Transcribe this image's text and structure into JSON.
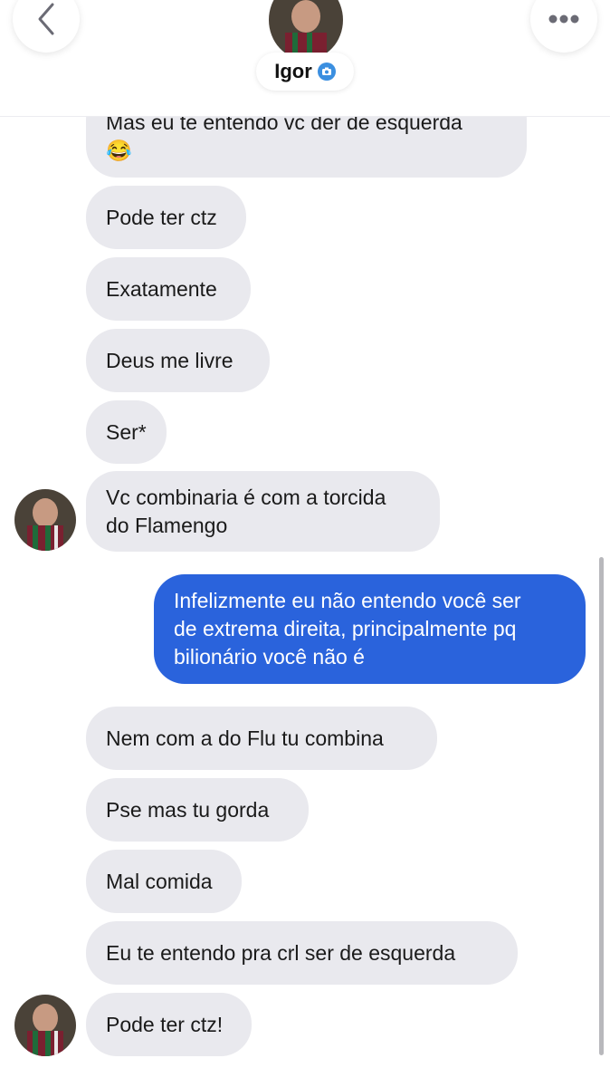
{
  "header": {
    "contact_name": "Igor",
    "icons": {
      "back": "chevron-left-icon",
      "more": "more-dots-icon",
      "verified": "verified-camera-icon"
    }
  },
  "colors": {
    "incoming_bubble": "#e9e9ee",
    "outgoing_bubble": "#2a63dc",
    "verified_badge": "#3b8fe0"
  },
  "messages": [
    {
      "dir": "in",
      "text": "Mas eu te entendo vc der de esquerda\n😂"
    },
    {
      "dir": "in",
      "text": "Pode ter ctz"
    },
    {
      "dir": "in",
      "text": "Exatamente"
    },
    {
      "dir": "in",
      "text": "Deus me livre"
    },
    {
      "dir": "in",
      "text": "Ser*"
    },
    {
      "dir": "in",
      "text": "Vc combinaria é com a torcida\ndo Flamengo"
    },
    {
      "dir": "out",
      "text": "Infelizmente eu não entendo você ser\nde extrema direita, principalmente pq\nbilionário você não é"
    },
    {
      "dir": "in",
      "text": "Nem com a do Flu tu combina"
    },
    {
      "dir": "in",
      "text": "Pse mas tu gorda"
    },
    {
      "dir": "in",
      "text": "Mal comida"
    },
    {
      "dir": "in",
      "text": "Eu te entendo pra crl ser de esquerda"
    },
    {
      "dir": "in",
      "text": "Pode ter ctz!"
    }
  ]
}
